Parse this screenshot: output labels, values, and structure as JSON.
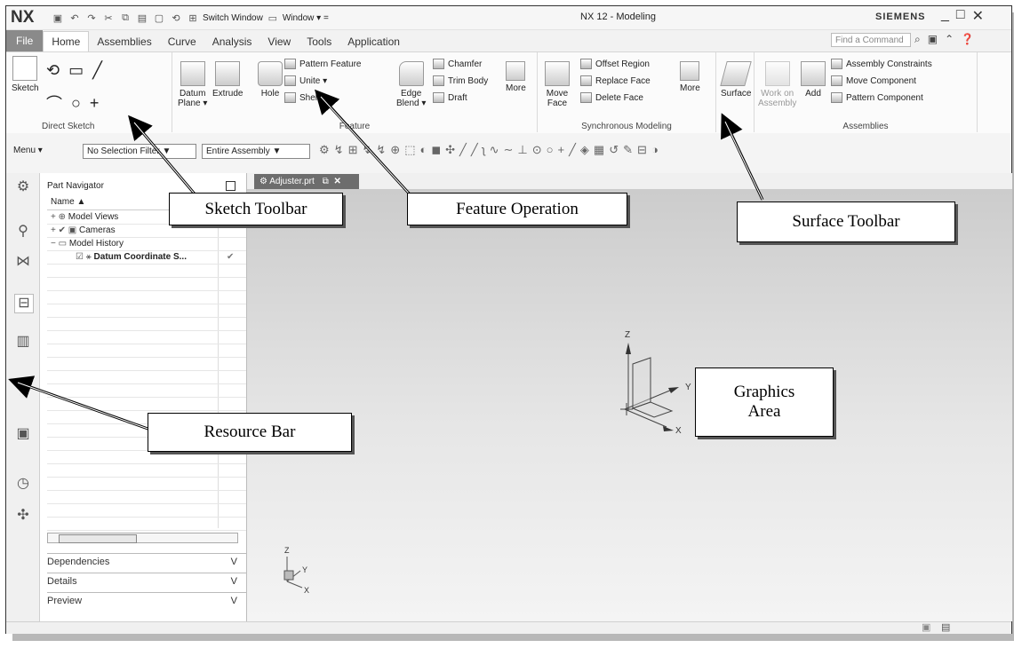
{
  "app": {
    "logo": "NX",
    "window_title": "NX 12 - Modeling",
    "brand": "SIEMENS",
    "switch_window": "Switch Window",
    "window_menu": "Window ▾ ="
  },
  "tabs": [
    {
      "label": "File"
    },
    {
      "label": "Home"
    },
    {
      "label": "Assemblies"
    },
    {
      "label": "Curve"
    },
    {
      "label": "Analysis"
    },
    {
      "label": "View"
    },
    {
      "label": "Tools"
    },
    {
      "label": "Application"
    }
  ],
  "find_command": {
    "placeholder": "Find a Command"
  },
  "ribbon": {
    "direct_sketch": {
      "sketch": "Sketch",
      "label": "Direct Sketch"
    },
    "feature": {
      "datum": "Datum",
      "datum2": "Plane ▾",
      "extrude": "Extrude",
      "hole": "Hole",
      "pattern": "Pattern Feature",
      "unite": "Unite ▾",
      "shell": "Shell",
      "edge": "Edge",
      "edge2": "Blend ▾",
      "chamfer": "Chamfer",
      "trim": "Trim Body",
      "draft": "Draft",
      "more": "More",
      "label": "Feature"
    },
    "sync": {
      "move": "Move",
      "move2": "Face",
      "offset": "Offset Region",
      "replace": "Replace Face",
      "delete": "Delete Face",
      "more": "More",
      "label": "Synchronous Modeling"
    },
    "surface": {
      "label": "Surface"
    },
    "assemblies": {
      "work": "Work on",
      "work2": "Assembly",
      "add": "Add",
      "constraints": "Assembly Constraints",
      "move_comp": "Move Component",
      "pattern_comp": "Pattern Component",
      "label": "Assemblies"
    }
  },
  "toolbar2": {
    "menu": "Menu ▾",
    "filter": "No Selection Filter ▼",
    "scope": "Entire Assembly ▼"
  },
  "navigator": {
    "title": "Part Navigator",
    "col_name": "Name ▲",
    "rows": [
      {
        "label": "Model Views",
        "prefix": "+ ⊕"
      },
      {
        "label": "Cameras",
        "prefix": "+ ✔ ▣"
      },
      {
        "label": "Model History",
        "prefix": "− ▭"
      },
      {
        "label": "Datum Coordinate S...",
        "prefix": "☑ ⚹"
      }
    ],
    "panes": [
      {
        "label": "Dependencies"
      },
      {
        "label": "Details"
      },
      {
        "label": "Preview"
      }
    ],
    "chevron": "V"
  },
  "document_tab": {
    "label": "Adjuster.prt"
  },
  "graphics": {
    "triad_main": {
      "z": "Z",
      "y": "Y",
      "x": "X"
    },
    "triad_small": {
      "z": "Z",
      "y": "Y",
      "x": "X"
    }
  },
  "callouts": {
    "sketch": "Sketch Toolbar",
    "feature": "Feature Operation",
    "surface": "Surface Toolbar",
    "resource": "Resource Bar",
    "graphics": "Graphics Area"
  }
}
